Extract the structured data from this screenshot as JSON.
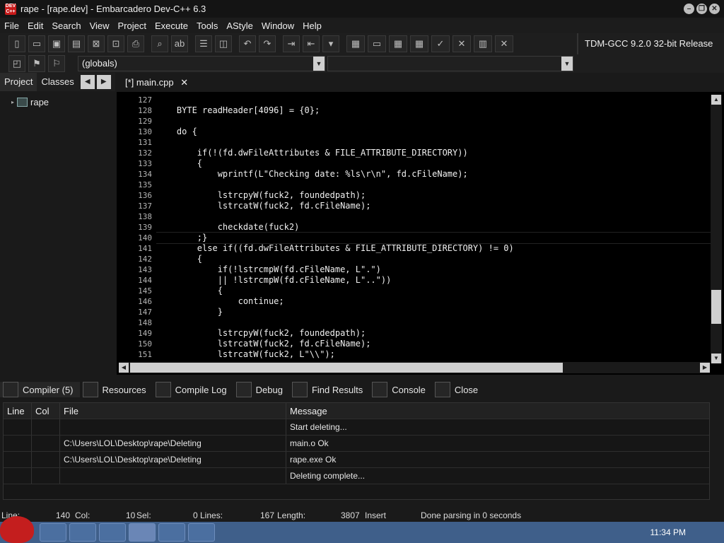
{
  "window": {
    "title": "rape - [rape.dev] - Embarcadero Dev-C++ 6.3",
    "app_icon_text": "DEV C++"
  },
  "menu": [
    "File",
    "Edit",
    "Search",
    "View",
    "Project",
    "Execute",
    "Tools",
    "AStyle",
    "Window",
    "Help"
  ],
  "toolbar": {
    "compiler": "TDM-GCC 9.2.0 32-bit Release",
    "scope": "(globals)"
  },
  "left_panel": {
    "tabs": [
      "Project",
      "Classes"
    ],
    "project_name": "rape"
  },
  "editor": {
    "tab": "[*] main.cpp",
    "tab_close": "✕",
    "lines": [
      {
        "n": "127",
        "t": ""
      },
      {
        "n": "128",
        "t": "    BYTE readHeader[4096] = {0};"
      },
      {
        "n": "129",
        "t": ""
      },
      {
        "n": "130",
        "t": "    do {"
      },
      {
        "n": "131",
        "t": ""
      },
      {
        "n": "132",
        "t": "        if(!(fd.dwFileAttributes & FILE_ATTRIBUTE_DIRECTORY))"
      },
      {
        "n": "133",
        "t": "        {"
      },
      {
        "n": "134",
        "t": "            wprintf(L\"Checking date: %ls\\r\\n\", fd.cFileName);"
      },
      {
        "n": "135",
        "t": ""
      },
      {
        "n": "136",
        "t": "            lstrcpyW(fuck2, foundedpath);"
      },
      {
        "n": "137",
        "t": "            lstrcatW(fuck2, fd.cFileName);"
      },
      {
        "n": "138",
        "t": ""
      },
      {
        "n": "139",
        "t": "            checkdate(fuck2)"
      },
      {
        "n": "140",
        "t": "        ;}"
      },
      {
        "n": "141",
        "t": "        else if((fd.dwFileAttributes & FILE_ATTRIBUTE_DIRECTORY) != 0)"
      },
      {
        "n": "142",
        "t": "        {"
      },
      {
        "n": "143",
        "t": "            if(!lstrcmpW(fd.cFileName, L\".\")"
      },
      {
        "n": "144",
        "t": "            || !lstrcmpW(fd.cFileName, L\"..\"))"
      },
      {
        "n": "145",
        "t": "            {"
      },
      {
        "n": "146",
        "t": "                continue;"
      },
      {
        "n": "147",
        "t": "            }"
      },
      {
        "n": "148",
        "t": ""
      },
      {
        "n": "149",
        "t": "            lstrcpyW(fuck2, foundedpath);"
      },
      {
        "n": "150",
        "t": "            lstrcatW(fuck2, fd.cFileName);"
      },
      {
        "n": "151",
        "t": "            lstrcatW(fuck2, L\"\\\\\");"
      }
    ]
  },
  "bottom_tabs": [
    "Compiler (5)",
    "Resources",
    "Compile Log",
    "Debug",
    "Find Results",
    "Console",
    "Close"
  ],
  "compiler_table": {
    "headers": [
      "Line",
      "Col",
      "File",
      "Message"
    ],
    "rows": [
      {
        "line": "",
        "col": "",
        "file": "",
        "message": "Start deleting..."
      },
      {
        "line": "",
        "col": "",
        "file": "C:\\Users\\LOL\\Desktop\\rape\\Deleting",
        "message": "main.o Ok"
      },
      {
        "line": "",
        "col": "",
        "file": "C:\\Users\\LOL\\Desktop\\rape\\Deleting",
        "message": "rape.exe Ok"
      },
      {
        "line": "",
        "col": "",
        "file": "",
        "message": "Deleting complete..."
      }
    ]
  },
  "status": {
    "line_label": "Line:",
    "line": "140",
    "col_label": "Col:",
    "col": "10",
    "sel_label": "Sel:",
    "sel": "0",
    "lines_label": "Lines:",
    "lines": "167",
    "length_label": "Length:",
    "length": "3807",
    "mode": "Insert",
    "message": "Done parsing in 0 seconds"
  },
  "taskbar": {
    "clock": "11:34 PM"
  }
}
